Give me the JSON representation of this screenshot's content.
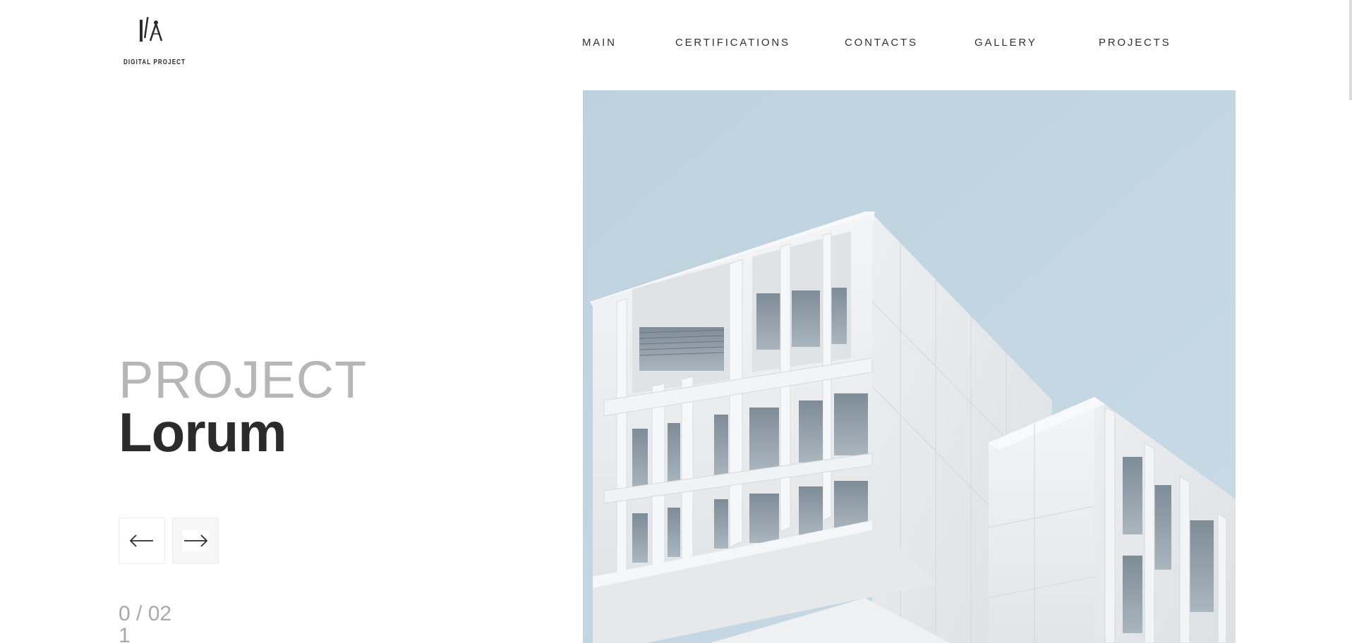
{
  "brand": {
    "name": "DIGITAL PROJECT",
    "logo_icon": "compass-ruler-icon"
  },
  "nav": {
    "items": [
      {
        "label": "MAIN"
      },
      {
        "label": "CERTIFICATIONS"
      },
      {
        "label": "CONTACTS"
      },
      {
        "label": "GALLERY"
      },
      {
        "label": "PROJECTS"
      }
    ]
  },
  "hero": {
    "kicker": "PROJECT",
    "title": "Lorum",
    "image": "modern-white-building-photo",
    "sky_color": "#c3d6e2"
  },
  "slider": {
    "prev_icon": "arrow-left-icon",
    "next_icon": "arrow-right-icon",
    "counter_line1": "0 / 02",
    "counter_line2": "1"
  },
  "colors": {
    "text_dark": "#2b2b2b",
    "text_muted": "#b7b5b6",
    "counter": "#a9a9a9"
  }
}
